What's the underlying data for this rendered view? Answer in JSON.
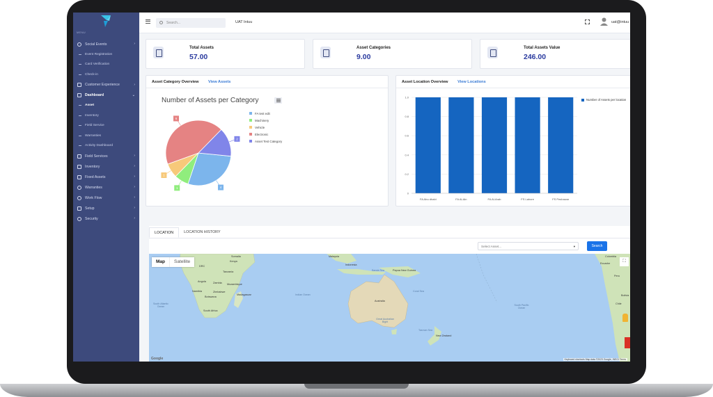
{
  "sidebar": {
    "menu_title": "MENU",
    "items": [
      {
        "label": "Social Events",
        "icon": "circle-icon"
      },
      {
        "label": "Event Registration",
        "sub": true
      },
      {
        "label": "Card Verification",
        "sub": true
      },
      {
        "label": "Check-in",
        "sub": true
      },
      {
        "label": "Customer Experience",
        "icon": "grid-icon"
      },
      {
        "label": "Dashboard",
        "icon": "grid-icon",
        "active": true
      },
      {
        "label": "Asset",
        "sub": true,
        "active": true
      },
      {
        "label": "Inventory",
        "sub": true
      },
      {
        "label": "Field Service",
        "sub": true
      },
      {
        "label": "Warranties",
        "sub": true
      },
      {
        "label": "Activity Dashboard",
        "sub": true
      },
      {
        "label": "Field Services",
        "icon": "grid-icon"
      },
      {
        "label": "Inventory",
        "icon": "box-icon"
      },
      {
        "label": "Fixed Assets",
        "icon": "box-icon"
      },
      {
        "label": "Warranties",
        "icon": "circle-icon"
      },
      {
        "label": "Work Flow",
        "icon": "circle-icon"
      },
      {
        "label": "Setup",
        "icon": "setup-icon"
      },
      {
        "label": "Security",
        "icon": "circle-icon"
      }
    ]
  },
  "topbar": {
    "search_placeholder": "Search...",
    "org_name": "UAT Intuu",
    "user_name": "uat@intuu"
  },
  "stats": [
    {
      "label": "Total Assets",
      "value": "57.00"
    },
    {
      "label": "Asset Categories",
      "value": "9.00"
    },
    {
      "label": "Total Assets Value",
      "value": "246.00"
    }
  ],
  "category_panel": {
    "title": "Asset Category Overview",
    "link": "View Assets"
  },
  "location_panel": {
    "title": "Asset Location Overview",
    "link": "View Locations"
  },
  "chart_data": [
    {
      "type": "pie",
      "title": "Number of Assets per Category",
      "categories": [
        "FA test edit",
        "Machinery",
        "Vehicle",
        "Electronic",
        "Asset Test Category"
      ],
      "values": [
        4,
        1,
        1,
        6,
        2
      ],
      "colors": [
        "#7cb5ec",
        "#90ed7d",
        "#f7c97a",
        "#e58383",
        "#8085e9"
      ],
      "legend": "right"
    },
    {
      "type": "bar",
      "categories": [
        "FA Abu dhabi",
        "FA Al-Ain",
        "FA Al-Arab",
        "FS Lahore",
        "FS Peshawar"
      ],
      "series": [
        {
          "name": "Number of Assets per location",
          "values": [
            1,
            1,
            1,
            1,
            1
          ]
        }
      ],
      "ylim": [
        0,
        1
      ],
      "yticks": [
        "0",
        "0.2",
        "0.4",
        "0.6",
        "0.8",
        "1.0"
      ],
      "color": "#1565c0",
      "grid": true,
      "legend": "top-right"
    }
  ],
  "tabs": [
    {
      "label": "LOCATION",
      "active": true
    },
    {
      "label": "LOCATION HISTORY",
      "active": false
    }
  ],
  "asset_select": {
    "placeholder": "Select Asset..."
  },
  "search_button": "Search",
  "map": {
    "type_map": "Map",
    "type_satellite": "Satellite",
    "google": "Google",
    "footer": "Keyboard shortcuts   Map data ©2023 Google, INEGI   Terms",
    "labels": [
      {
        "text": "Somalia"
      },
      {
        "text": "Kenya"
      },
      {
        "text": "DRC"
      },
      {
        "text": "Tanzania"
      },
      {
        "text": "Angola"
      },
      {
        "text": "Zambia"
      },
      {
        "text": "Mozambique"
      },
      {
        "text": "Namibia"
      },
      {
        "text": "Zimbabwe"
      },
      {
        "text": "Botswana"
      },
      {
        "text": "Madagascar"
      },
      {
        "text": "South Africa"
      },
      {
        "text": "Malaysia"
      },
      {
        "text": "Indonesia"
      },
      {
        "text": "Papua New Guinea"
      },
      {
        "text": "Australia"
      },
      {
        "text": "New Zealand"
      },
      {
        "text": "Colombia"
      },
      {
        "text": "Ecuador"
      },
      {
        "text": "Peru"
      },
      {
        "text": "Bolivia"
      },
      {
        "text": "Chile"
      }
    ],
    "seas": [
      {
        "text": "South Atlantic Ocean"
      },
      {
        "text": "Indian Ocean"
      },
      {
        "text": "Coral Sea"
      },
      {
        "text": "Great Australian Bight"
      },
      {
        "text": "Tasman Sea"
      },
      {
        "text": "South Pacific Ocean"
      },
      {
        "text": "Banda Sea"
      }
    ]
  }
}
